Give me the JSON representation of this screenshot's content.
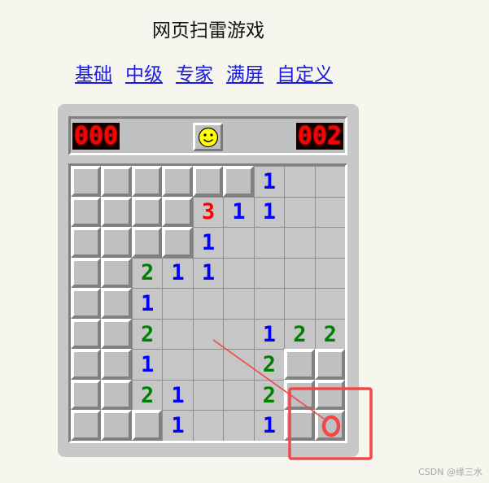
{
  "page": {
    "title": "网页扫雷游戏"
  },
  "nav": [
    {
      "label": "基础"
    },
    {
      "label": "中级"
    },
    {
      "label": "专家"
    },
    {
      "label": "满屏"
    },
    {
      "label": "自定义"
    }
  ],
  "game": {
    "mine_counter": "000",
    "timer": "002",
    "face_icon": "smiley-face-icon",
    "cols": 9,
    "rows": 9,
    "board": [
      "######1..",
      "####311..",
      "####1....",
      "##211....",
      "##1......",
      "##2...122",
      "##1...2##",
      "##21..2##",
      "###1..1##"
    ],
    "number_colors": {
      "1": "#0000ff",
      "2": "#008000",
      "3": "#ff0000"
    }
  },
  "annotation": {
    "color": "#f04848",
    "icon": "circle-annotation-icon"
  },
  "watermark": "CSDN @缘三水"
}
